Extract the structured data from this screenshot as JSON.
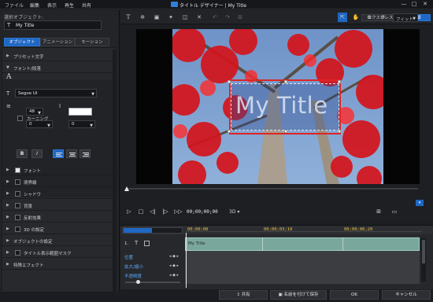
{
  "titlebar": {
    "menus": [
      "ファイル",
      "編集",
      "表示",
      "再生",
      "共有"
    ],
    "title": "タイトル デザイナー | My Title",
    "window_buttons": {
      "minimize": "—",
      "maximize": "□",
      "close": "✕"
    }
  },
  "left_panel": {
    "selected_label": "選択オブジェクト:",
    "selected_value": "My Title",
    "tabs": [
      "オブジェクト",
      "アニメーション",
      "モーション"
    ],
    "sections": {
      "preset": "プリセット文字",
      "font_para": "フォント/段落",
      "font": "フォント",
      "border": "境界線",
      "shadow": "シャドウ",
      "background": "背景",
      "reflection": "反射効果",
      "3d": "3D の設定",
      "object_settings": "オブジェクトの設定",
      "mask": "タイトル表示範囲マスク",
      "special": "特殊エフェクト"
    },
    "font_family": "Segoe UI",
    "font_size": "48",
    "line_spacing": "0",
    "char_spacing": "0",
    "kerning": "カーニング",
    "bold": "B",
    "italic": "I"
  },
  "toolbar": {
    "mode_express": "エクスプレス",
    "mode_detail": "詳細",
    "fit": "フィット"
  },
  "preview": {
    "title_text": "My Title",
    "timecode": "00;00;00;00",
    "mode_3d": "3D"
  },
  "timeline": {
    "ticks": [
      "00;00;00",
      "00;00;03;10",
      "00;00;06;20"
    ],
    "clip_name": "My Title",
    "track_index": "1.",
    "tracks": [
      "位置",
      "拡大/縮小",
      "不透明度"
    ]
  },
  "bottombar": {
    "share": "共有",
    "save_as": "名前を付けて保存",
    "ok": "OK",
    "cancel": "キャンセル"
  },
  "colors": {
    "accent": "#1f67c4",
    "selection_border": "#e02424",
    "clip": "#7aa79c",
    "timecode": "#e8c24a"
  }
}
